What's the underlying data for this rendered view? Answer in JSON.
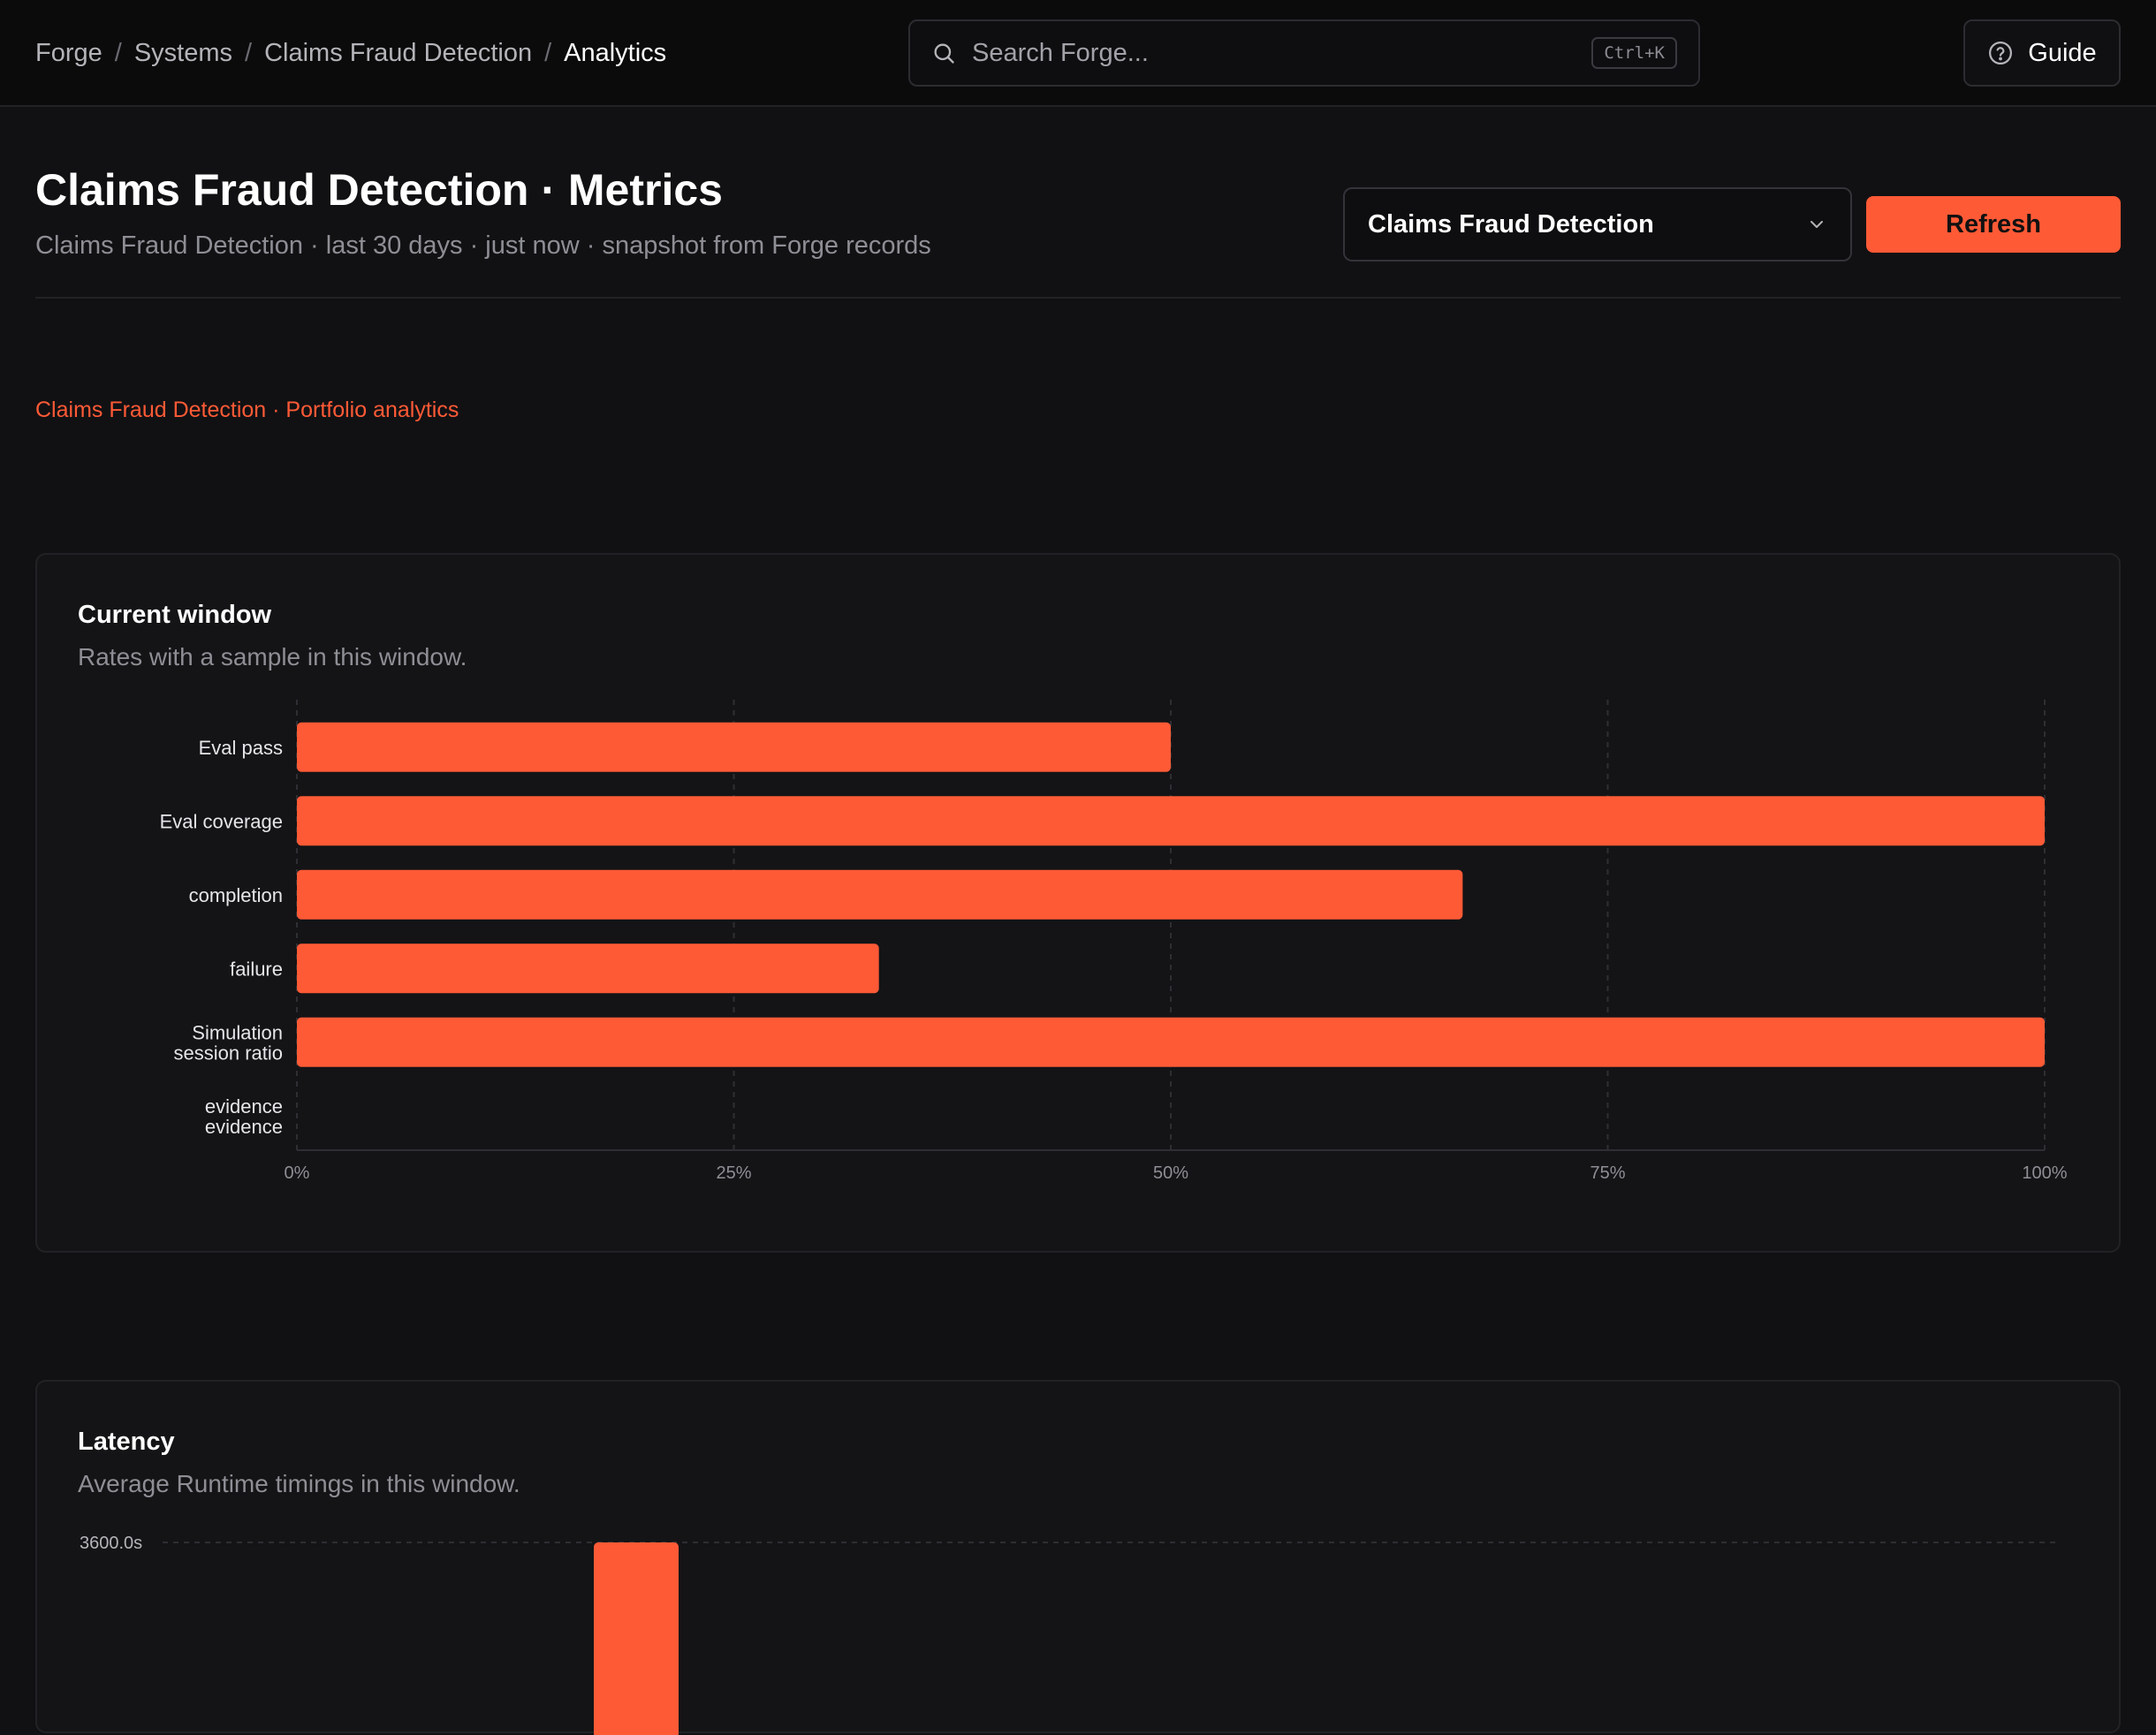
{
  "breadcrumb": {
    "items": [
      "Forge",
      "Systems",
      "Claims Fraud Detection"
    ],
    "separator": "/",
    "current": "Analytics"
  },
  "search": {
    "placeholder": "Search Forge...",
    "shortcut": "Ctrl+K"
  },
  "guide_label": "Guide",
  "page": {
    "title": "Claims Fraud Detection · Metrics",
    "subtitle": "Claims Fraud Detection · last 30 days · just now · snapshot from Forge records"
  },
  "system_select": {
    "value": "Claims Fraud Detection"
  },
  "refresh_label": "Refresh",
  "section_link": "Claims Fraud Detection · Portfolio analytics",
  "rates_card": {
    "title": "Current window",
    "subtitle": "Rates with a sample in this window."
  },
  "latency_card": {
    "title": "Latency",
    "subtitle": "Average Runtime timings in this window."
  },
  "colors": {
    "accent": "#ff5a36",
    "background": "#111113",
    "card": "#141416"
  },
  "icons": [
    "search-icon",
    "help-circle-icon",
    "chevron-down-icon"
  ],
  "chart_data": [
    {
      "type": "bar",
      "orientation": "horizontal",
      "categories": [
        [
          "Eval pass"
        ],
        [
          "Eval coverage"
        ],
        [
          "completion"
        ],
        [
          "failure"
        ],
        [
          "Simulation",
          "session ratio"
        ],
        [
          "evidence",
          "evidence"
        ]
      ],
      "values": [
        50,
        100,
        66.7,
        33.3,
        100,
        0
      ],
      "xlim": [
        0,
        100
      ],
      "ticks": [
        "0%",
        "25%",
        "50%",
        "75%",
        "100%"
      ],
      "grid": true
    },
    {
      "type": "bar",
      "ytick_top": "3600.0s",
      "grid": true
    }
  ]
}
